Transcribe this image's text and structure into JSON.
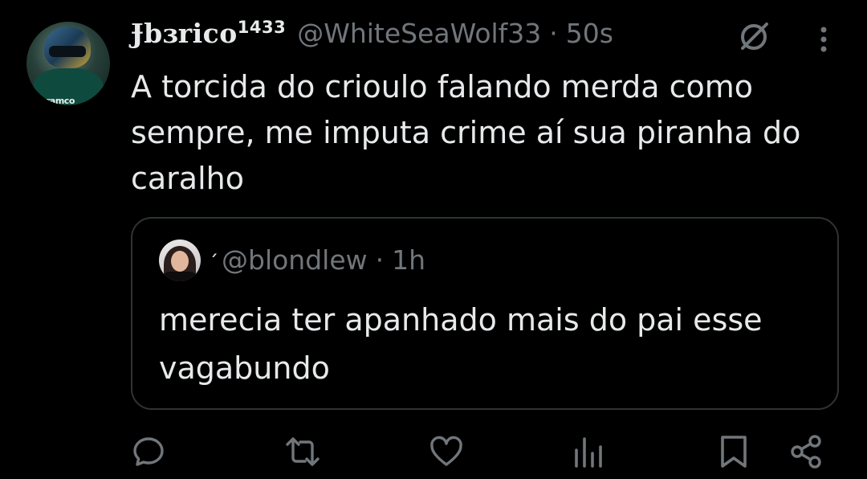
{
  "tweet": {
    "display_name": "Ɉbɜrico",
    "display_name_suffix": "1433",
    "handle": "@WhiteSeaWolf33",
    "separator": "·",
    "time": "50s",
    "text": "A torcida do crioulo falando merda como sempre, me imputa crime aí sua piranha do caralho",
    "avatar_text": "ramco"
  },
  "quote": {
    "display_name": "ˊ",
    "handle": "@blondlew",
    "separator": "·",
    "time": "1h",
    "text": "merecia ter apanhado mais do pai esse vagabundo"
  },
  "icons": {
    "grok": "grok-slash-icon",
    "more": "more-vertical-icon",
    "reply": "reply-icon",
    "retweet": "retweet-icon",
    "like": "heart-icon",
    "views": "analytics-icon",
    "bookmark": "bookmark-icon",
    "share": "share-icon"
  },
  "colors": {
    "background": "#000000",
    "primary_text": "#e7e9ea",
    "secondary_text": "#71767b",
    "border": "#2f3336"
  }
}
